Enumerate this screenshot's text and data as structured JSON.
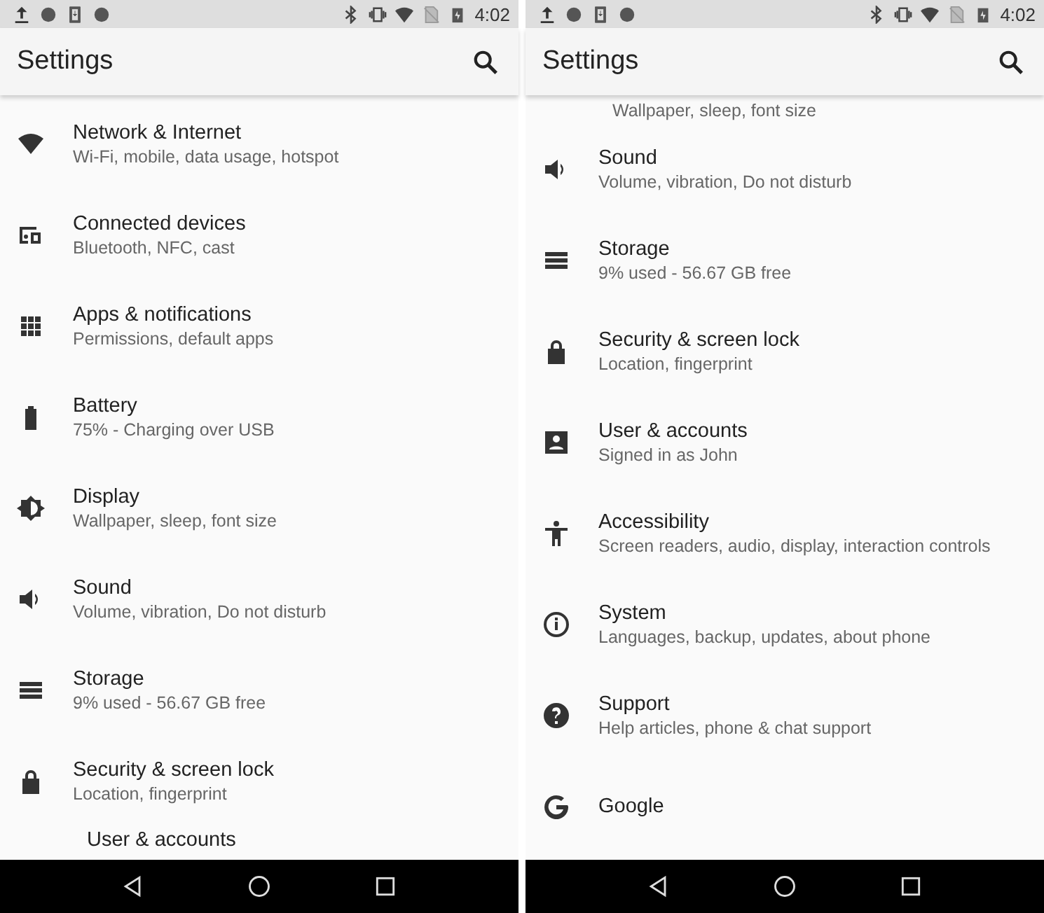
{
  "screens": [
    {
      "status_bar": {
        "time": "4:02"
      },
      "title": "Settings",
      "items": [
        {
          "kind": "network",
          "title": "Network & Internet",
          "subtitle": "Wi-Fi, mobile, data usage, hotspot"
        },
        {
          "kind": "devices",
          "title": "Connected devices",
          "subtitle": "Bluetooth, NFC, cast"
        },
        {
          "kind": "apps",
          "title": "Apps & notifications",
          "subtitle": "Permissions, default apps"
        },
        {
          "kind": "battery",
          "title": "Battery",
          "subtitle": "75% - Charging over USB"
        },
        {
          "kind": "display",
          "title": "Display",
          "subtitle": "Wallpaper, sleep, font size"
        },
        {
          "kind": "sound",
          "title": "Sound",
          "subtitle": "Volume, vibration, Do not disturb"
        },
        {
          "kind": "storage",
          "title": "Storage",
          "subtitle": "9% used - 56.67 GB free"
        },
        {
          "kind": "lock",
          "title": "Security & screen lock",
          "subtitle": "Location, fingerprint"
        },
        {
          "kind": "partial",
          "title": "User & accounts"
        }
      ]
    },
    {
      "status_bar": {
        "time": "4:02"
      },
      "title": "Settings",
      "items": [
        {
          "kind": "partial",
          "subtitle": "Wallpaper, sleep, font size"
        },
        {
          "kind": "sound",
          "title": "Sound",
          "subtitle": "Volume, vibration, Do not disturb"
        },
        {
          "kind": "storage",
          "title": "Storage",
          "subtitle": "9% used - 56.67 GB free"
        },
        {
          "kind": "lock",
          "title": "Security & screen lock",
          "subtitle": "Location, fingerprint"
        },
        {
          "kind": "account",
          "title": "User & accounts",
          "subtitle": "Signed in as John"
        },
        {
          "kind": "accessibility",
          "title": "Accessibility",
          "subtitle": "Screen readers, audio, display, interaction controls"
        },
        {
          "kind": "info",
          "title": "System",
          "subtitle": "Languages, backup, updates, about phone"
        },
        {
          "kind": "help",
          "title": "Support",
          "subtitle": "Help articles, phone & chat support"
        },
        {
          "kind": "google",
          "title": "Google"
        }
      ]
    }
  ]
}
